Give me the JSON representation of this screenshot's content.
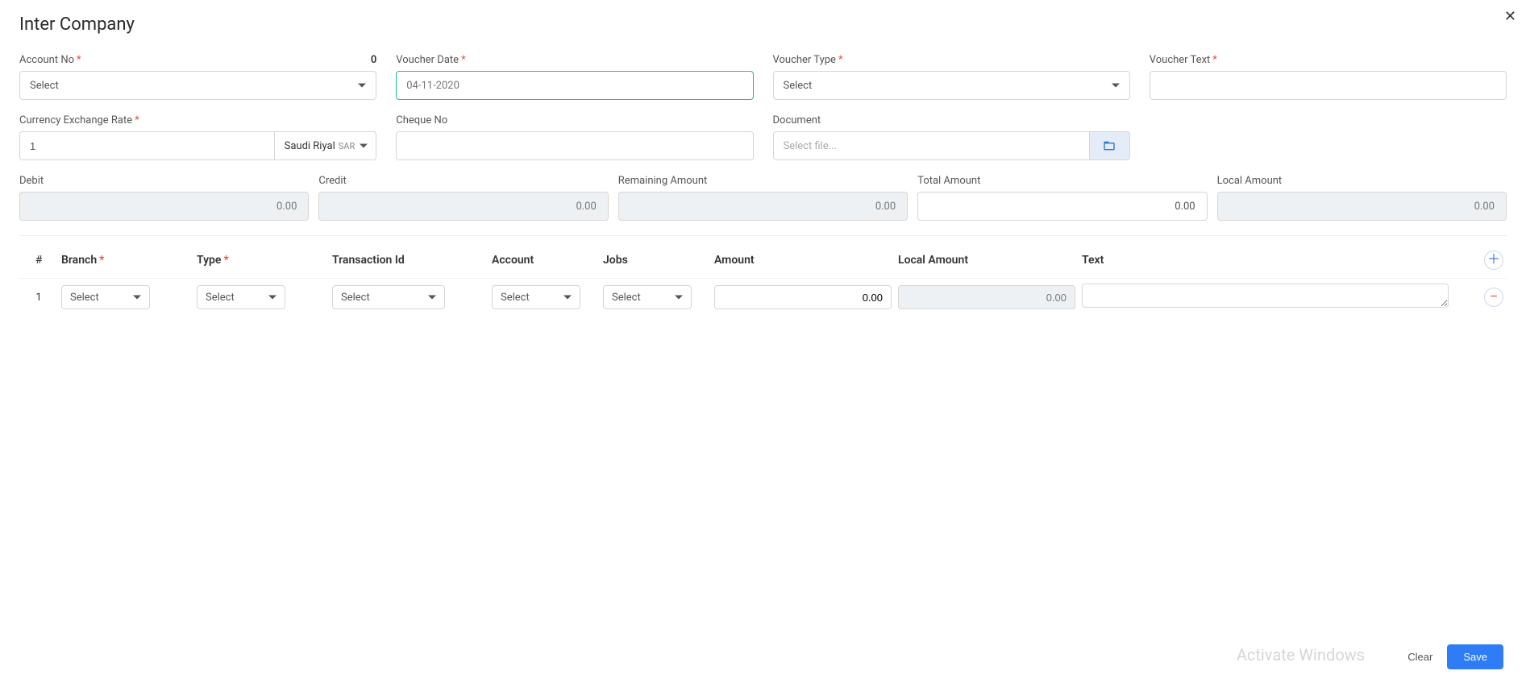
{
  "modal": {
    "title": "Inter Company",
    "close_symbol": "✕"
  },
  "fields": {
    "account_no": {
      "label": "Account No",
      "value": "Select",
      "badge": "0"
    },
    "voucher_date": {
      "label": "Voucher Date",
      "value": "04-11-2020"
    },
    "voucher_type": {
      "label": "Voucher Type",
      "value": "Select"
    },
    "voucher_text": {
      "label": "Voucher Text",
      "value": ""
    },
    "exchange_rate": {
      "label": "Currency Exchange Rate",
      "value": "1"
    },
    "currency": {
      "name": "Saudi Riyal",
      "code": "SAR"
    },
    "cheque_no": {
      "label": "Cheque No",
      "value": ""
    },
    "document": {
      "label": "Document",
      "placeholder": "Select file..."
    }
  },
  "amounts": {
    "debit": {
      "label": "Debit",
      "value": "0.00"
    },
    "credit": {
      "label": "Credit",
      "value": "0.00"
    },
    "remaining": {
      "label": "Remaining Amount",
      "value": "0.00"
    },
    "total": {
      "label": "Total Amount",
      "value": "0.00"
    },
    "local": {
      "label": "Local Amount",
      "value": "0.00"
    }
  },
  "grid": {
    "header": {
      "num": "#",
      "branch": "Branch",
      "type": "Type",
      "transaction": "Transaction Id",
      "account": "Account",
      "jobs": "Jobs",
      "amount": "Amount",
      "local_amount": "Local Amount",
      "text": "Text"
    },
    "row": {
      "num": "1",
      "branch": "Select",
      "type": "Select",
      "transaction": "Select",
      "account": "Select",
      "jobs": "Select",
      "amount": "0.00",
      "local_amount": "0.00",
      "text": ""
    }
  },
  "footer": {
    "clear": "Clear",
    "save": "Save"
  },
  "watermark": "Activate Windows"
}
